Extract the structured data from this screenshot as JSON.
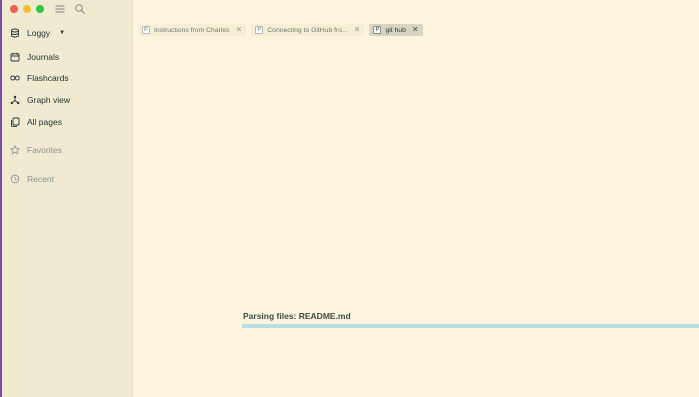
{
  "window": {
    "traffic_lights": [
      "#ef5b57",
      "#f5bf2f",
      "#2bc83f"
    ]
  },
  "sidebar": {
    "graph_name": "Loggy",
    "items": [
      {
        "label": "Journals",
        "icon": "calendar-icon"
      },
      {
        "label": "Flashcards",
        "icon": "infinity-icon"
      },
      {
        "label": "Graph view",
        "icon": "graph-icon"
      },
      {
        "label": "All pages",
        "icon": "pages-icon"
      }
    ],
    "sections": [
      {
        "label": "Favorites",
        "icon": "star-icon"
      },
      {
        "label": "Recent",
        "icon": "history-icon"
      }
    ]
  },
  "tabs": [
    {
      "badge": "P",
      "label": "Instructions from Charles",
      "active": false
    },
    {
      "badge": "P",
      "label": "Connecting to GitHub fro...",
      "active": false
    },
    {
      "badge": "P",
      "label": "git hub",
      "active": true
    }
  ],
  "status": {
    "parsing_text": "Parsing files: README.md",
    "progress": 1.0,
    "progress_color": "#b8e0e4"
  }
}
